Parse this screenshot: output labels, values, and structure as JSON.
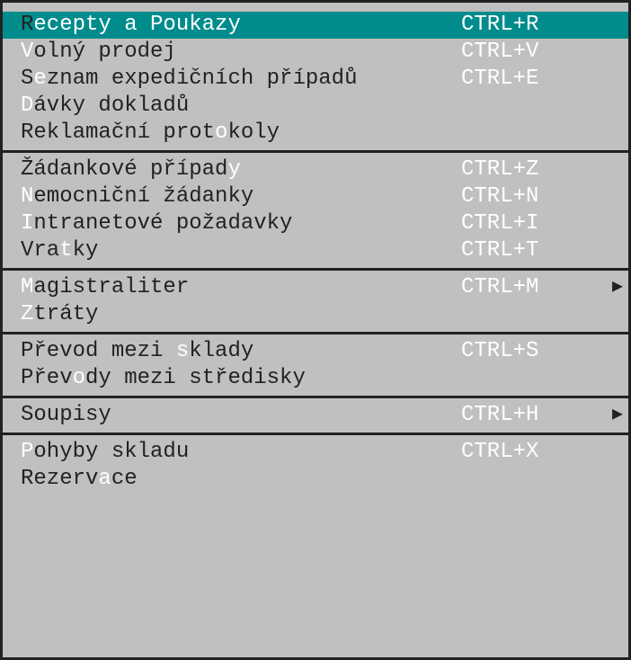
{
  "groups": [
    {
      "items": [
        {
          "label": "Recepty a Poukazy",
          "hotkeyIndex": 0,
          "shortcut": "CTRL+R",
          "selected": true,
          "submenu": false
        },
        {
          "label": "Volný prodej",
          "hotkeyIndex": 0,
          "shortcut": "CTRL+V",
          "selected": false,
          "submenu": false
        },
        {
          "label": "Seznam expedičních případů",
          "hotkeyIndex": 1,
          "shortcut": "CTRL+E",
          "selected": false,
          "submenu": false
        },
        {
          "label": "Dávky dokladů",
          "hotkeyIndex": 0,
          "shortcut": "",
          "selected": false,
          "submenu": false
        },
        {
          "label": "Reklamační protokoly",
          "hotkeyIndex": 15,
          "shortcut": "",
          "selected": false,
          "submenu": false
        }
      ]
    },
    {
      "items": [
        {
          "label": "Žádankové případy",
          "hotkeyIndex": 16,
          "shortcut": "CTRL+Z",
          "selected": false,
          "submenu": false
        },
        {
          "label": "Nemocniční žádanky",
          "hotkeyIndex": 0,
          "shortcut": "CTRL+N",
          "selected": false,
          "submenu": false
        },
        {
          "label": "Intranetové požadavky",
          "hotkeyIndex": 0,
          "shortcut": "CTRL+I",
          "selected": false,
          "submenu": false
        },
        {
          "label": "Vratky",
          "hotkeyIndex": 3,
          "shortcut": "CTRL+T",
          "selected": false,
          "submenu": false
        }
      ]
    },
    {
      "items": [
        {
          "label": "Magistraliter",
          "hotkeyIndex": 0,
          "shortcut": "CTRL+M",
          "selected": false,
          "submenu": true
        },
        {
          "label": "Ztráty",
          "hotkeyIndex": 0,
          "shortcut": "",
          "selected": false,
          "submenu": false
        }
      ]
    },
    {
      "items": [
        {
          "label": "Převod mezi sklady",
          "hotkeyIndex": 12,
          "shortcut": "CTRL+S",
          "selected": false,
          "submenu": false
        },
        {
          "label": "Převody mezi středisky",
          "hotkeyIndex": 4,
          "shortcut": "",
          "selected": false,
          "submenu": false
        }
      ]
    },
    {
      "items": [
        {
          "label": "Soupisy",
          "hotkeyIndex": -1,
          "shortcut": "CTRL+H",
          "selected": false,
          "submenu": true
        }
      ]
    },
    {
      "items": [
        {
          "label": "Pohyby skladu",
          "hotkeyIndex": 0,
          "shortcut": "CTRL+X",
          "selected": false,
          "submenu": false
        },
        {
          "label": "Rezervace",
          "hotkeyIndex": 6,
          "shortcut": "",
          "selected": false,
          "submenu": false
        }
      ]
    }
  ],
  "arrowGlyph": "▶"
}
